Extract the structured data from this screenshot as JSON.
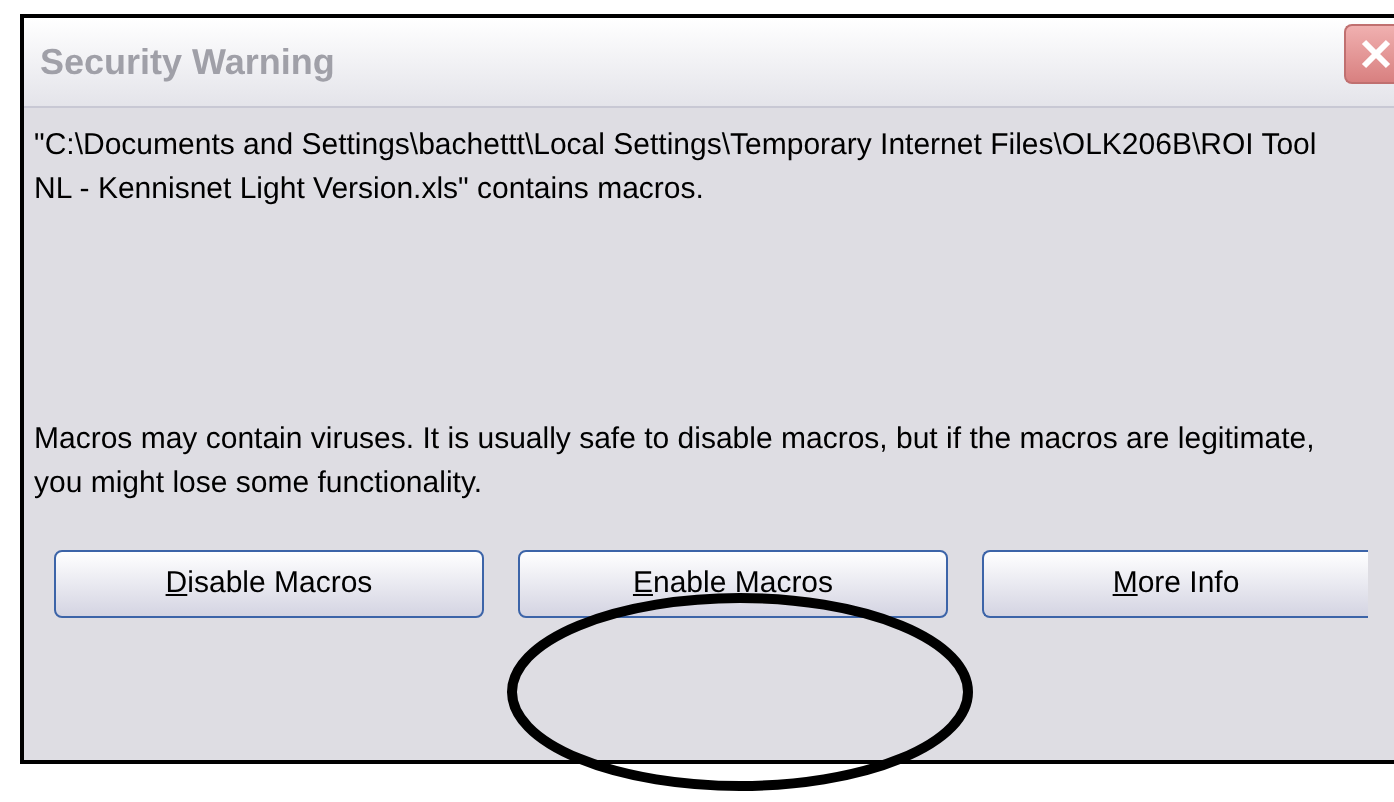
{
  "window": {
    "title": "Security Warning"
  },
  "message": "\"C:\\Documents and Settings\\bachettt\\Local Settings\\Temporary Internet Files\\OLK206B\\ROI Tool NL - Kennisnet Light Version.xls\" contains macros.",
  "warning": "Macros may contain viruses. It is usually safe to disable macros, but if the macros are legitimate, you might lose some functionality.",
  "buttons": [
    {
      "label": "Disable Macros"
    },
    {
      "label": "Enable Macros"
    },
    {
      "label": "More Info"
    }
  ],
  "annotation": {
    "kind": "ellipse"
  }
}
